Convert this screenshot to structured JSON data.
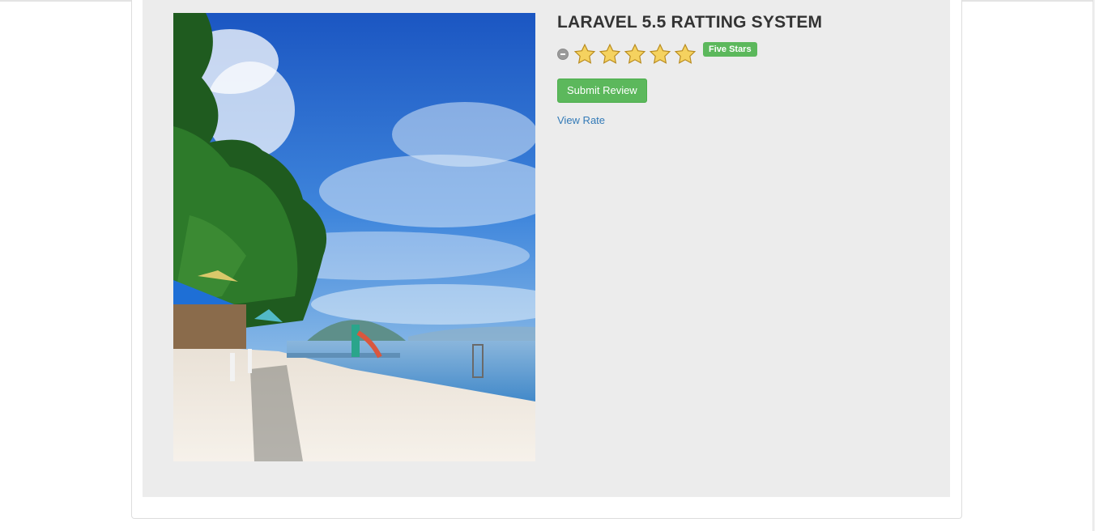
{
  "product": {
    "title": "LARAVEL 5.5 RATTING SYSTEM",
    "image_alt": "beach photo",
    "rating": {
      "value": 5,
      "max": 5,
      "caption": "Five Stars",
      "star_color": "#f5d25f",
      "badge_color": "#5cb85c"
    },
    "submit_label": "Submit Review",
    "view_link_label": "View Rate"
  },
  "colors": {
    "panel_bg": "#ececec",
    "link": "#337ab7",
    "button": "#5cb85c"
  }
}
